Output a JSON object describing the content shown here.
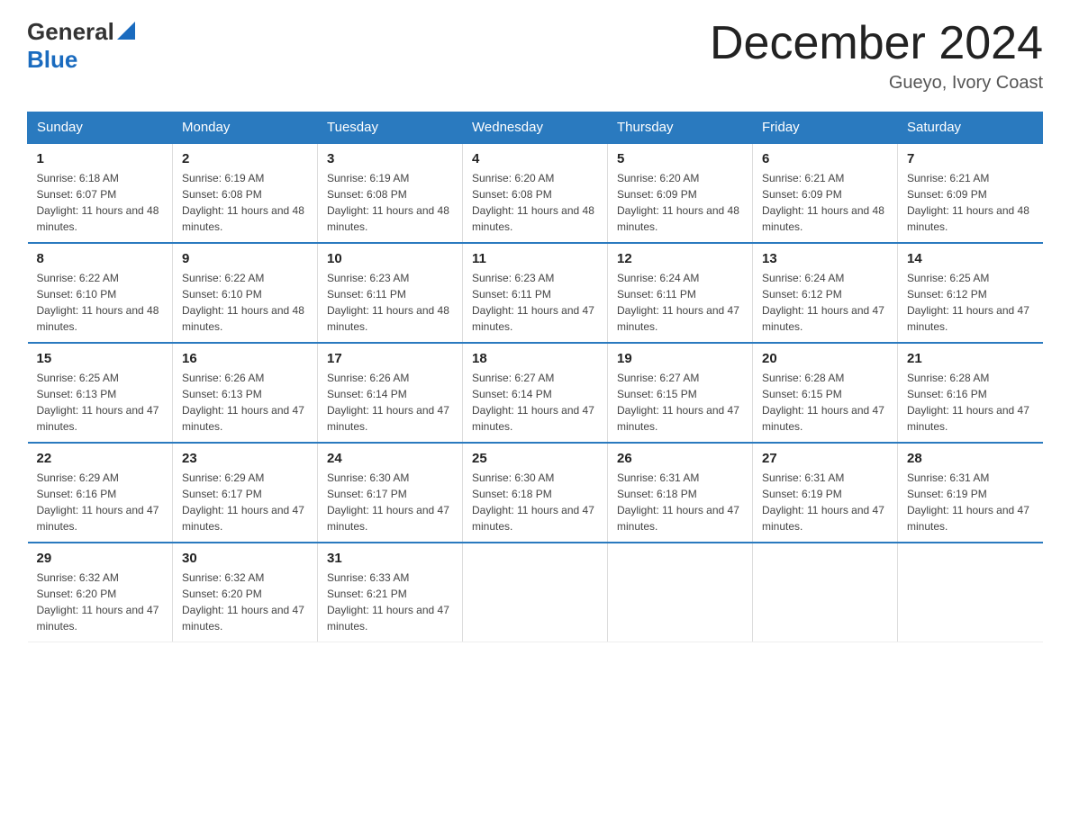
{
  "header": {
    "logo_general": "General",
    "logo_blue": "Blue",
    "month_title": "December 2024",
    "location": "Gueyo, Ivory Coast"
  },
  "calendar": {
    "days_of_week": [
      "Sunday",
      "Monday",
      "Tuesday",
      "Wednesday",
      "Thursday",
      "Friday",
      "Saturday"
    ],
    "weeks": [
      [
        {
          "day": "1",
          "sunrise": "6:18 AM",
          "sunset": "6:07 PM",
          "daylight": "11 hours and 48 minutes."
        },
        {
          "day": "2",
          "sunrise": "6:19 AM",
          "sunset": "6:08 PM",
          "daylight": "11 hours and 48 minutes."
        },
        {
          "day": "3",
          "sunrise": "6:19 AM",
          "sunset": "6:08 PM",
          "daylight": "11 hours and 48 minutes."
        },
        {
          "day": "4",
          "sunrise": "6:20 AM",
          "sunset": "6:08 PM",
          "daylight": "11 hours and 48 minutes."
        },
        {
          "day": "5",
          "sunrise": "6:20 AM",
          "sunset": "6:09 PM",
          "daylight": "11 hours and 48 minutes."
        },
        {
          "day": "6",
          "sunrise": "6:21 AM",
          "sunset": "6:09 PM",
          "daylight": "11 hours and 48 minutes."
        },
        {
          "day": "7",
          "sunrise": "6:21 AM",
          "sunset": "6:09 PM",
          "daylight": "11 hours and 48 minutes."
        }
      ],
      [
        {
          "day": "8",
          "sunrise": "6:22 AM",
          "sunset": "6:10 PM",
          "daylight": "11 hours and 48 minutes."
        },
        {
          "day": "9",
          "sunrise": "6:22 AM",
          "sunset": "6:10 PM",
          "daylight": "11 hours and 48 minutes."
        },
        {
          "day": "10",
          "sunrise": "6:23 AM",
          "sunset": "6:11 PM",
          "daylight": "11 hours and 48 minutes."
        },
        {
          "day": "11",
          "sunrise": "6:23 AM",
          "sunset": "6:11 PM",
          "daylight": "11 hours and 47 minutes."
        },
        {
          "day": "12",
          "sunrise": "6:24 AM",
          "sunset": "6:11 PM",
          "daylight": "11 hours and 47 minutes."
        },
        {
          "day": "13",
          "sunrise": "6:24 AM",
          "sunset": "6:12 PM",
          "daylight": "11 hours and 47 minutes."
        },
        {
          "day": "14",
          "sunrise": "6:25 AM",
          "sunset": "6:12 PM",
          "daylight": "11 hours and 47 minutes."
        }
      ],
      [
        {
          "day": "15",
          "sunrise": "6:25 AM",
          "sunset": "6:13 PM",
          "daylight": "11 hours and 47 minutes."
        },
        {
          "day": "16",
          "sunrise": "6:26 AM",
          "sunset": "6:13 PM",
          "daylight": "11 hours and 47 minutes."
        },
        {
          "day": "17",
          "sunrise": "6:26 AM",
          "sunset": "6:14 PM",
          "daylight": "11 hours and 47 minutes."
        },
        {
          "day": "18",
          "sunrise": "6:27 AM",
          "sunset": "6:14 PM",
          "daylight": "11 hours and 47 minutes."
        },
        {
          "day": "19",
          "sunrise": "6:27 AM",
          "sunset": "6:15 PM",
          "daylight": "11 hours and 47 minutes."
        },
        {
          "day": "20",
          "sunrise": "6:28 AM",
          "sunset": "6:15 PM",
          "daylight": "11 hours and 47 minutes."
        },
        {
          "day": "21",
          "sunrise": "6:28 AM",
          "sunset": "6:16 PM",
          "daylight": "11 hours and 47 minutes."
        }
      ],
      [
        {
          "day": "22",
          "sunrise": "6:29 AM",
          "sunset": "6:16 PM",
          "daylight": "11 hours and 47 minutes."
        },
        {
          "day": "23",
          "sunrise": "6:29 AM",
          "sunset": "6:17 PM",
          "daylight": "11 hours and 47 minutes."
        },
        {
          "day": "24",
          "sunrise": "6:30 AM",
          "sunset": "6:17 PM",
          "daylight": "11 hours and 47 minutes."
        },
        {
          "day": "25",
          "sunrise": "6:30 AM",
          "sunset": "6:18 PM",
          "daylight": "11 hours and 47 minutes."
        },
        {
          "day": "26",
          "sunrise": "6:31 AM",
          "sunset": "6:18 PM",
          "daylight": "11 hours and 47 minutes."
        },
        {
          "day": "27",
          "sunrise": "6:31 AM",
          "sunset": "6:19 PM",
          "daylight": "11 hours and 47 minutes."
        },
        {
          "day": "28",
          "sunrise": "6:31 AM",
          "sunset": "6:19 PM",
          "daylight": "11 hours and 47 minutes."
        }
      ],
      [
        {
          "day": "29",
          "sunrise": "6:32 AM",
          "sunset": "6:20 PM",
          "daylight": "11 hours and 47 minutes."
        },
        {
          "day": "30",
          "sunrise": "6:32 AM",
          "sunset": "6:20 PM",
          "daylight": "11 hours and 47 minutes."
        },
        {
          "day": "31",
          "sunrise": "6:33 AM",
          "sunset": "6:21 PM",
          "daylight": "11 hours and 47 minutes."
        },
        null,
        null,
        null,
        null
      ]
    ]
  }
}
